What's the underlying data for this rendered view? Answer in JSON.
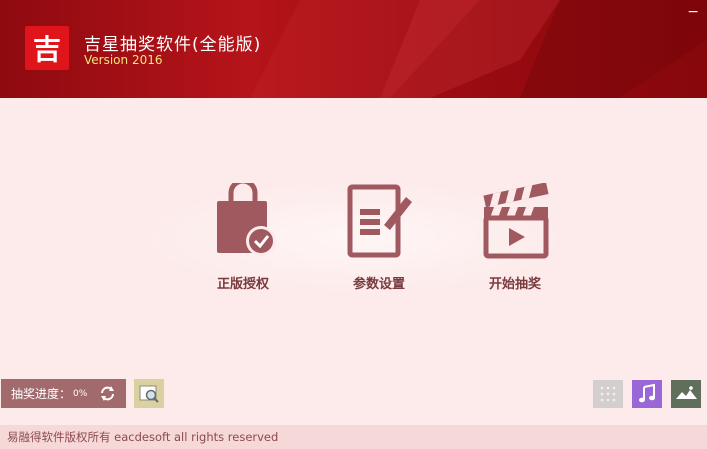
{
  "app": {
    "logo_char": "吉",
    "title": "吉星抽奖软件(全能版)",
    "version": "Version 2016",
    "minimize_glyph": "−"
  },
  "actions": [
    {
      "label": "正版授权",
      "icon": "shopping-bag-check-icon"
    },
    {
      "label": "参数设置",
      "icon": "document-edit-icon"
    },
    {
      "label": "开始抽奖",
      "icon": "clapperboard-play-icon"
    }
  ],
  "toolbar": {
    "progress_label": "抽奖进度：",
    "progress_value": "0%",
    "refresh_icon": "refresh-icon",
    "search_icon": "image-search-icon",
    "tools": [
      {
        "name": "grid-icon",
        "color": "#d3cfcf"
      },
      {
        "name": "music-icon",
        "color": "#9a68d6"
      },
      {
        "name": "landscape-icon",
        "color": "#5f6f5c"
      }
    ]
  },
  "footer": {
    "copyright": "易融得软件版权所有 eacdesoft all rights reserved"
  },
  "colors": {
    "header": "#a00d12",
    "accent_icon": "#a0595f",
    "background": "#fdeaea"
  }
}
